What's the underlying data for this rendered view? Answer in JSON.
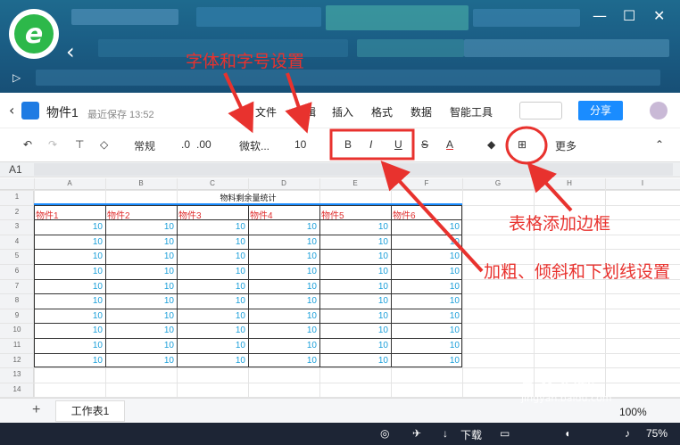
{
  "app": {
    "doc_title": "物件1",
    "save_status": "最近保存 13:52",
    "share_label": "分享"
  },
  "menu": [
    "文件",
    "编辑",
    "插入",
    "格式",
    "数据",
    "智能工具"
  ],
  "toolbar": {
    "number_format": "常规",
    "dec_decrease": ".0",
    "dec_increase": ".00",
    "font_name": "微软...",
    "font_size": "10",
    "bold": "B",
    "italic": "I",
    "underline": "U",
    "strike": "S",
    "font_color": "A",
    "more": "更多"
  },
  "formula_bar": {
    "cell_ref": "A1"
  },
  "columns": [
    "A",
    "B",
    "C",
    "D",
    "E",
    "F",
    "G",
    "H",
    "I"
  ],
  "rows": [
    "1",
    "2",
    "3",
    "4",
    "5",
    "6",
    "7",
    "8",
    "9",
    "10",
    "11",
    "12",
    "13",
    "14"
  ],
  "sheet": {
    "title": "物料剩余量统计",
    "headers": [
      "物件1",
      "物件2",
      "物件3",
      "物件4",
      "物件5",
      "物件6"
    ],
    "values": [
      [
        "10",
        "10",
        "10",
        "10",
        "10",
        "10"
      ],
      [
        "10",
        "10",
        "10",
        "10",
        "10",
        "10"
      ],
      [
        "10",
        "10",
        "10",
        "10",
        "10",
        "10"
      ],
      [
        "10",
        "10",
        "10",
        "10",
        "10",
        "10"
      ],
      [
        "10",
        "10",
        "10",
        "10",
        "10",
        "10"
      ],
      [
        "10",
        "10",
        "10",
        "10",
        "10",
        "10"
      ],
      [
        "10",
        "10",
        "10",
        "10",
        "10",
        "10"
      ],
      [
        "10",
        "10",
        "10",
        "10",
        "10",
        "10"
      ],
      [
        "10",
        "10",
        "10",
        "10",
        "10",
        "10"
      ],
      [
        "10",
        "10",
        "10",
        "10",
        "10",
        "10"
      ]
    ]
  },
  "sheet_tabs": {
    "active": "工作表1"
  },
  "zoom": "100%",
  "taskbar": {
    "download": "下载",
    "battery": "75%"
  },
  "annotations": {
    "font": "字体和字号设置",
    "style": "加粗、倾斜和下划线设置",
    "border": "表格添加边框"
  },
  "watermark": {
    "brand": "Bai 经验",
    "url": "jingyan.baidu.com"
  },
  "colors": {
    "annotation": "#e8322e",
    "header_text": "#e03030",
    "value_text": "#1a9ed9",
    "share": "#1a8cff"
  }
}
